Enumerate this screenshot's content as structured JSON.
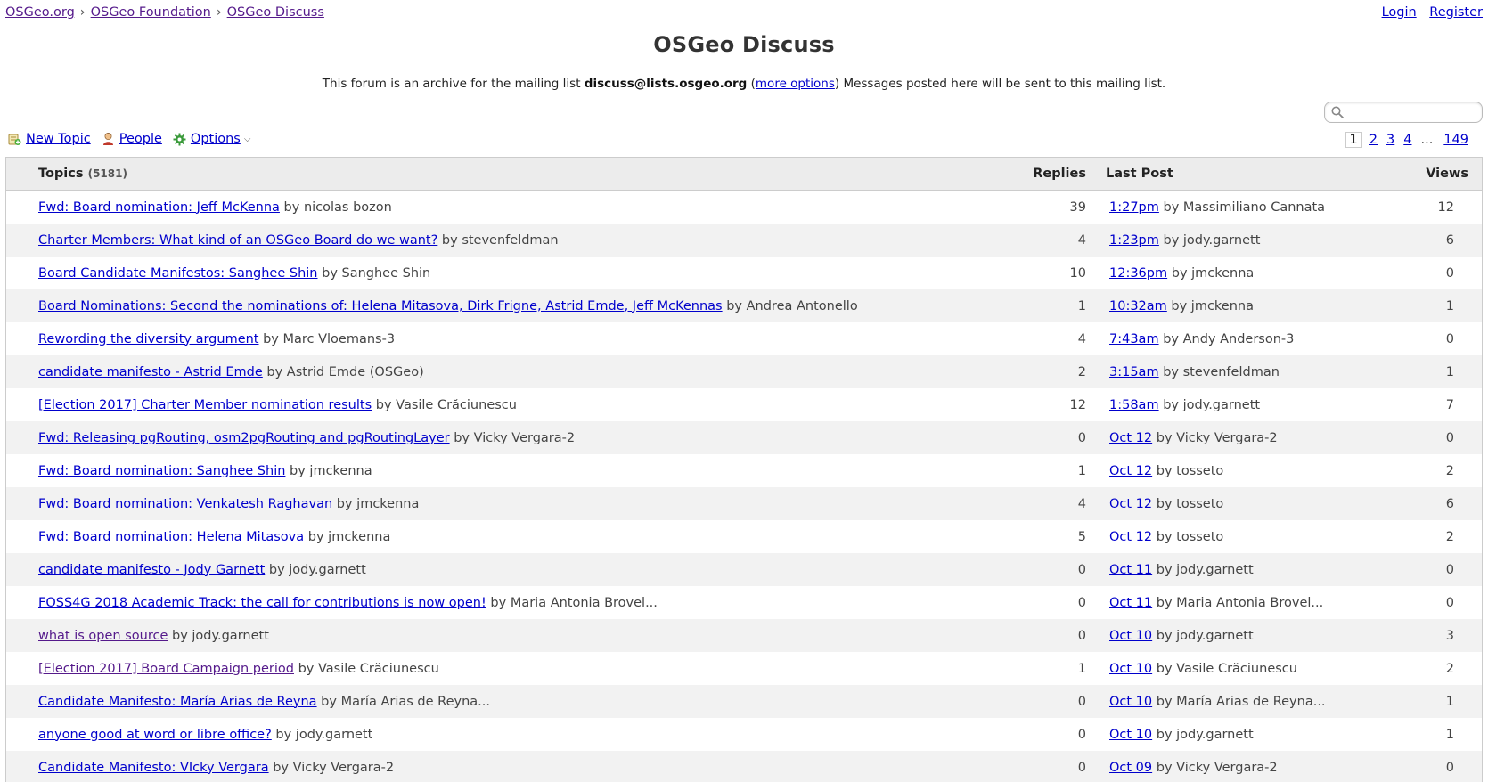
{
  "breadcrumbs": [
    "OSGeo.org",
    "OSGeo Foundation",
    "OSGeo Discuss"
  ],
  "breadcrumb_separator": "›",
  "auth": {
    "login": "Login",
    "register": "Register"
  },
  "title": "OSGeo Discuss",
  "description": {
    "prefix": "This forum is an archive for the mailing list ",
    "email": "discuss@lists.osgeo.org",
    "open_paren": " (",
    "more_options": "more options",
    "suffix": ") Messages posted here will be sent to this mailing list."
  },
  "search": {
    "placeholder": "",
    "value": ""
  },
  "toolbar": {
    "new_topic": "New Topic",
    "people": "People",
    "options": "Options"
  },
  "pagination": {
    "current": "1",
    "pages": [
      "2",
      "3",
      "4"
    ],
    "ellipsis": "...",
    "last": "149"
  },
  "table": {
    "headers": {
      "topics": "Topics",
      "topics_count": "(5181)",
      "replies": "Replies",
      "last_post": "Last Post",
      "views": "Views"
    },
    "rows": [
      {
        "title": "Fwd: Board nomination: Jeff McKenna",
        "author": "by nicolas bozon",
        "replies": "39",
        "last_time": "1:27pm",
        "last_by": "by Massimiliano Cannata",
        "views": "12",
        "visited": false
      },
      {
        "title": "Charter Members: What kind of an OSGeo Board do we want?",
        "author": "by stevenfeldman",
        "replies": "4",
        "last_time": "1:23pm",
        "last_by": "by jody.garnett",
        "views": "6",
        "visited": false
      },
      {
        "title": "Board Candidate Manifestos: Sanghee Shin",
        "author": "by Sanghee Shin",
        "replies": "10",
        "last_time": "12:36pm",
        "last_by": "by jmckenna",
        "views": "0",
        "visited": false
      },
      {
        "title": "Board Nominations: Second the nominations of: Helena Mitasova, Dirk Frigne, Astrid Emde, Jeff McKennas",
        "author": "by Andrea Antonello",
        "replies": "1",
        "last_time": "10:32am",
        "last_by": "by jmckenna",
        "views": "1",
        "visited": false
      },
      {
        "title": "Rewording the diversity argument",
        "author": "by Marc Vloemans-3",
        "replies": "4",
        "last_time": "7:43am",
        "last_by": "by Andy Anderson-3",
        "views": "0",
        "visited": false
      },
      {
        "title": "candidate manifesto - Astrid Emde",
        "author": "by Astrid Emde (OSGeo)",
        "replies": "2",
        "last_time": "3:15am",
        "last_by": "by stevenfeldman",
        "views": "1",
        "visited": false
      },
      {
        "title": "[Election 2017] Charter Member nomination results",
        "author": "by Vasile Crăciunescu",
        "replies": "12",
        "last_time": "1:58am",
        "last_by": "by jody.garnett",
        "views": "7",
        "visited": false
      },
      {
        "title": "Fwd: Releasing pgRouting, osm2pgRouting and pgRoutingLayer",
        "author": "by Vicky Vergara-2",
        "replies": "0",
        "last_time": "Oct 12",
        "last_by": "by Vicky Vergara-2",
        "views": "0",
        "visited": false
      },
      {
        "title": "Fwd: Board nomination: Sanghee Shin",
        "author": "by jmckenna",
        "replies": "1",
        "last_time": "Oct 12",
        "last_by": "by tosseto",
        "views": "2",
        "visited": false
      },
      {
        "title": "Fwd: Board nomination: Venkatesh Raghavan",
        "author": "by jmckenna",
        "replies": "4",
        "last_time": "Oct 12",
        "last_by": "by tosseto",
        "views": "6",
        "visited": false
      },
      {
        "title": "Fwd: Board nomination: Helena Mitasova",
        "author": "by jmckenna",
        "replies": "5",
        "last_time": "Oct 12",
        "last_by": "by tosseto",
        "views": "2",
        "visited": false
      },
      {
        "title": "candidate manifesto - Jody Garnett",
        "author": "by jody.garnett",
        "replies": "0",
        "last_time": "Oct 11",
        "last_by": "by jody.garnett",
        "views": "0",
        "visited": false
      },
      {
        "title": "FOSS4G 2018 Academic Track: the call for contributions is now open!",
        "author": "by Maria Antonia Brovel...",
        "replies": "0",
        "last_time": "Oct 11",
        "last_by": "by Maria Antonia Brovel...",
        "views": "0",
        "visited": false
      },
      {
        "title": "what is open source",
        "author": "by jody.garnett",
        "replies": "0",
        "last_time": "Oct 10",
        "last_by": "by jody.garnett",
        "views": "3",
        "visited": true
      },
      {
        "title": "[Election 2017] Board Campaign period",
        "author": "by Vasile Crăciunescu",
        "replies": "1",
        "last_time": "Oct 10",
        "last_by": "by Vasile Crăciunescu",
        "views": "2",
        "visited": true
      },
      {
        "title": "Candidate Manifesto: María Arias de Reyna",
        "author": "by María Arias de Reyna...",
        "replies": "0",
        "last_time": "Oct 10",
        "last_by": "by María Arias de Reyna...",
        "views": "1",
        "visited": false
      },
      {
        "title": "anyone good at word or libre office?",
        "author": "by jody.garnett",
        "replies": "0",
        "last_time": "Oct 10",
        "last_by": "by jody.garnett",
        "views": "1",
        "visited": false
      },
      {
        "title": "Candidate Manifesto: VIcky Vergara",
        "author": "by Vicky Vergara-2",
        "replies": "0",
        "last_time": "Oct 09",
        "last_by": "by Vicky Vergara-2",
        "views": "0",
        "visited": false
      }
    ]
  },
  "colors": {
    "link": "#0000cc",
    "visited": "#551a8b",
    "header_bg": "#ececec",
    "stripe": "#f2f2f2"
  },
  "icons": {
    "new_topic": "new-topic-icon",
    "people": "people-icon",
    "options": "gear-icon",
    "search": "search-icon"
  }
}
